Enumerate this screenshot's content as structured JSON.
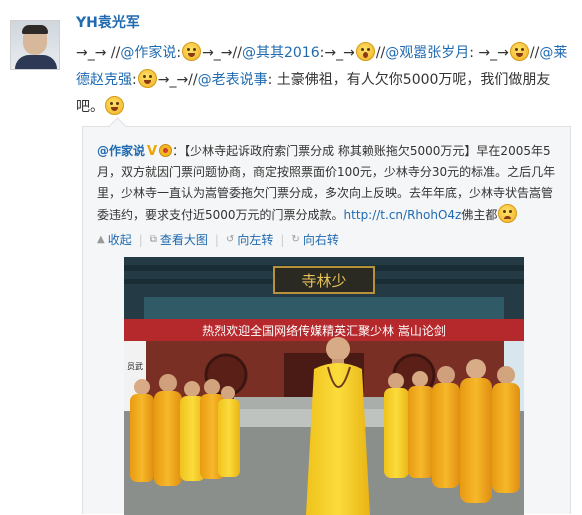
{
  "user": {
    "name": "YH袁光军"
  },
  "post": {
    "seg1": "→_→ //",
    "m1": "@作家说",
    "c1": ":",
    "seg2": "→_→//",
    "m2": "@其其2016",
    "c2": ":→_→",
    "seg3": "//",
    "m3": "@观嚣张岁月",
    "c3": ": →_→",
    "seg4": "//",
    "m4": "@莱德赵克强",
    "c4": ":",
    "seg5": "→_→//",
    "m5": "@老表说事",
    "c5": ": 土豪佛祖，有人欠你5000万呢，我们做朋友吧。"
  },
  "emoticons": [
    "laugh-emoticon",
    "laugh-emoticon",
    "yawn-emoticon",
    "laugh-emoticon",
    "laugh-emoticon",
    "laugh-emoticon",
    "cry-emoticon"
  ],
  "quote": {
    "author": "@作家说",
    "verified": "V",
    "text": "：【少林寺起诉政府索门票分成 称其赖账拖欠5000万元】早在2005年5月，双方就因门票问题协商，商定按照票面价100元，少林寺分30元的标准。之后几年里，少林寺一直认为嵩管委拖欠门票分成，多次向上反映。去年年底，少林寺状告嵩管委违约，要求支付近5000万元的门票分成款。",
    "link": "http://t.cn/RhohO4z",
    "tail": "佛主都",
    "actions": {
      "collapse": "收起",
      "view_large": "查看大图",
      "rotate_left": "向左转",
      "rotate_right": "向右转"
    }
  },
  "photo": {
    "banner": "热烈欢迎全国网络传媒精英汇聚少林 嵩山论剑",
    "plaque": "寺林少",
    "side_sign": "员武"
  },
  "colors": {
    "link": "#1f6ab0",
    "quote_bg": "#f5f6f7",
    "robe": "#f2a818",
    "banner": "#b5282c",
    "wall": "#7a2f24"
  }
}
